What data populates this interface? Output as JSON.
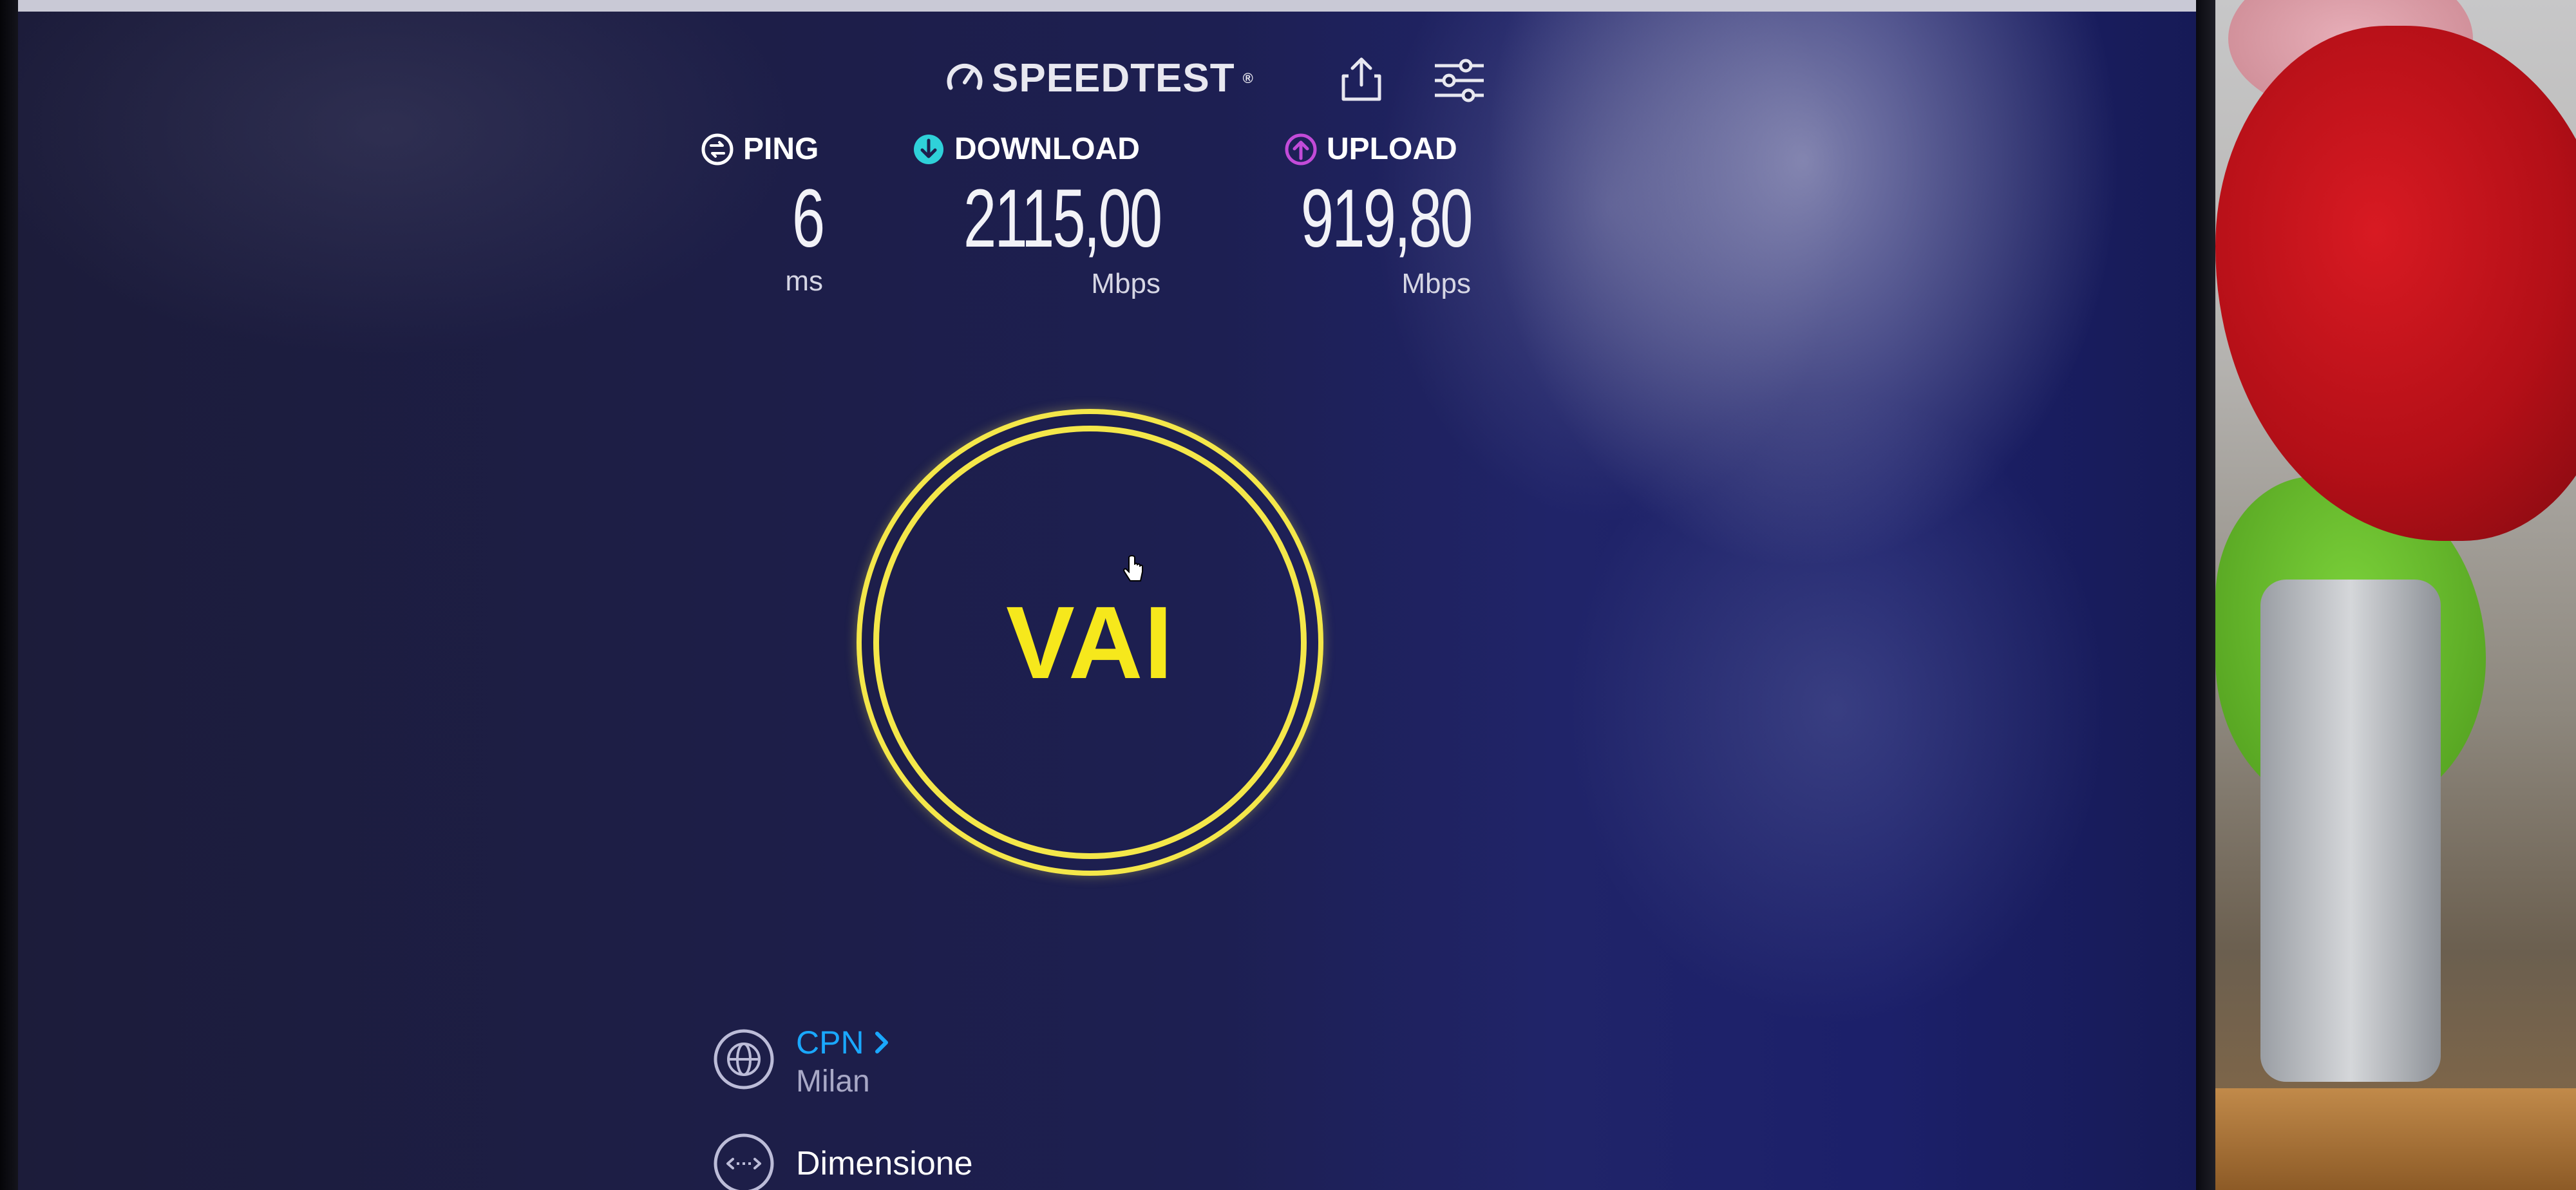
{
  "brand": {
    "name": "SPEEDTEST",
    "trademark": "®"
  },
  "metrics": {
    "ping": {
      "label": "PING",
      "value": "6",
      "unit": "ms"
    },
    "download": {
      "label": "DOWNLOAD",
      "value": "2115,00",
      "unit": "Mbps"
    },
    "upload": {
      "label": "UPLOAD",
      "value": "919,80",
      "unit": "Mbps"
    }
  },
  "go_button": {
    "label": "VAI"
  },
  "server": {
    "isp": "CPN",
    "city": "Milan"
  },
  "connection": {
    "label": "Dimensione"
  },
  "colors": {
    "background": "#1d1f52",
    "accent_yellow": "#f6e81c",
    "download_cyan": "#2fd1d9",
    "upload_magenta": "#c24bd8",
    "link_blue": "#1aa8ff"
  },
  "icons": [
    "gauge-icon",
    "share-icon",
    "settings-sliders-icon",
    "ping-icon",
    "download-icon",
    "upload-icon",
    "globe-icon",
    "connections-icon",
    "hand-cursor-icon"
  ]
}
